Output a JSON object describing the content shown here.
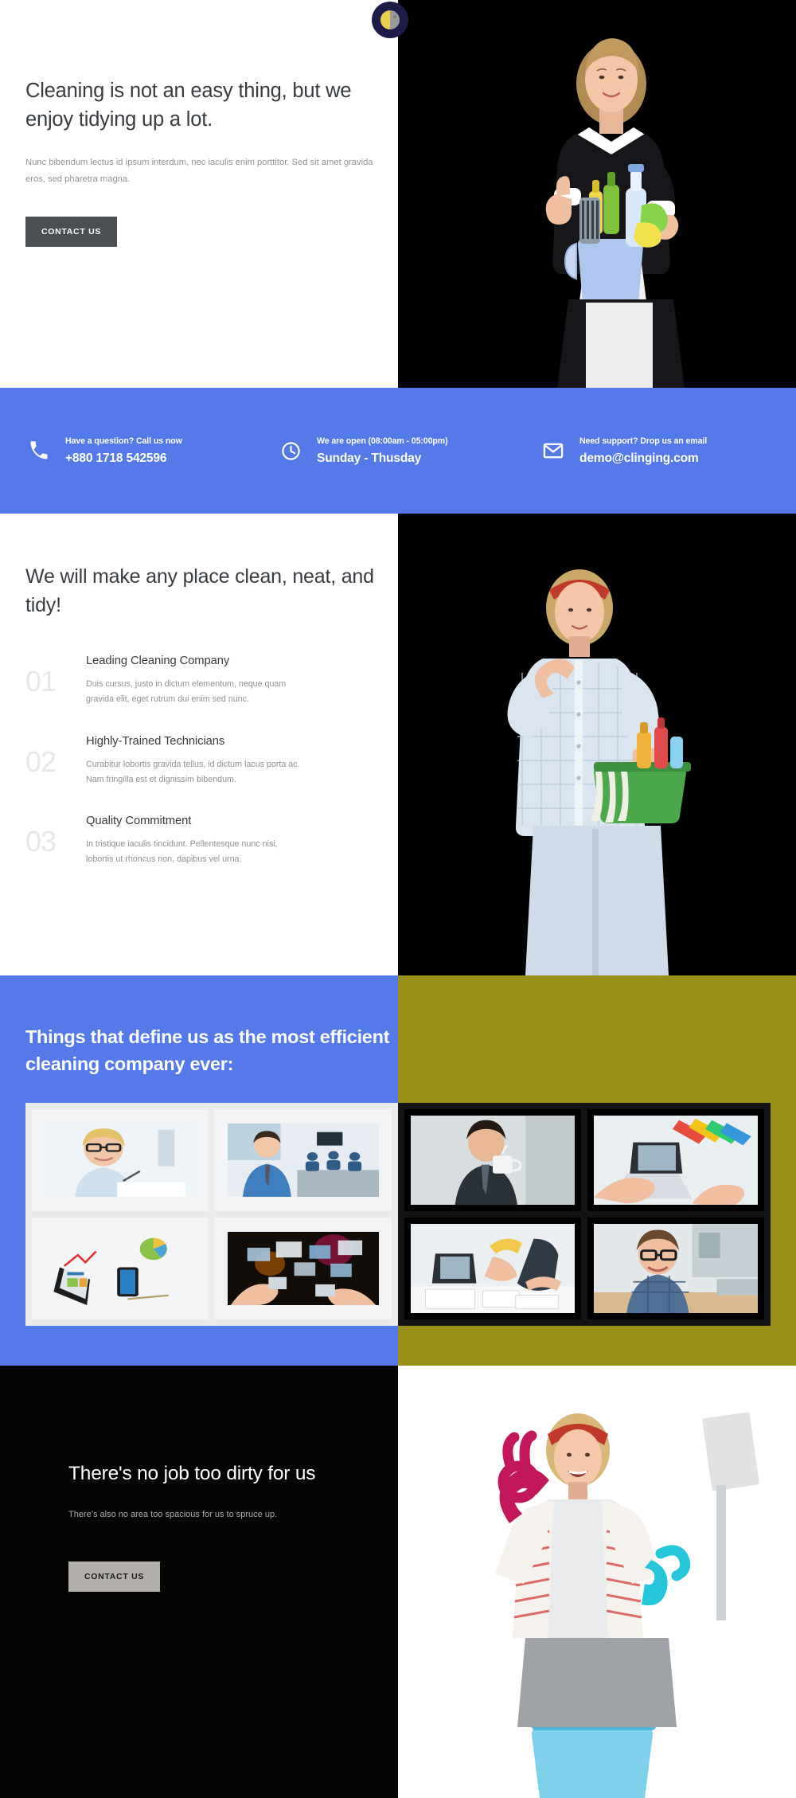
{
  "brand": {
    "logo_icon": "moon-badge-logo"
  },
  "hero": {
    "title": "Cleaning is not an easy thing, but we enjoy tidying up a lot.",
    "subtitle": "Nunc bibendum lectus id ipsum interdum, nec iaculis enim porttitor. Sed sit amet gravida eros, sed pharetra magna.",
    "cta_label": "CONTACT US",
    "image_alt": "maid-with-cleaning-supplies"
  },
  "infobar": {
    "background_color": "#5479e8",
    "items": [
      {
        "icon": "phone-icon",
        "label": "Have a question? Call us now",
        "value": "+880 1718 542596"
      },
      {
        "icon": "clock-icon",
        "label": "We are open (08:00am - 05:00pm)",
        "value": "Sunday - Thusday"
      },
      {
        "icon": "envelope-icon",
        "label": "Need support? Drop us an email",
        "value": "demo@clinging.com"
      }
    ]
  },
  "features": {
    "title": "We will make any place clean, neat, and tidy!",
    "items": [
      {
        "number": "01",
        "title": "Leading Cleaning Company",
        "desc": "Duis cursus, justo in dictum elementum, neque quam gravida elit, eget rutrum dui enim sed nunc."
      },
      {
        "number": "02",
        "title": "Highly-Trained Technicians",
        "desc": "Curabitur lobortis gravida tellus, id dictum lacus porta ac. Nam fringilla est et dignissim bibendum."
      },
      {
        "number": "03",
        "title": "Quality Commitment",
        "desc": "In tristique iaculis tincidunt. Pellentesque nunc nisi, lobortis ut rhoncus non, dapibus vel urna."
      }
    ],
    "image_alt": "woman-with-cleaning-basket"
  },
  "gallery": {
    "heading": "Things that define us as the most efficient cleaning company ever:",
    "left_background": "#5479e8",
    "right_background": "#9a9018",
    "light_tiles": [
      {
        "alt": "businesswoman-with-glasses-writing"
      },
      {
        "alt": "businessman-in-meeting-room"
      },
      {
        "alt": "tablet-with-business-charts"
      },
      {
        "alt": "hands-holding-digital-screens"
      }
    ],
    "dark_tiles": [
      {
        "alt": "man-drinking-coffee"
      },
      {
        "alt": "hands-on-laptop-with-color-swatches"
      },
      {
        "alt": "team-working-at-desk"
      },
      {
        "alt": "man-with-glasses-smiling-at-office"
      }
    ]
  },
  "cta": {
    "title": "There's no job too dirty for us",
    "subtitle": "There’s also no area too spacious for us to spruce up.",
    "button_label": "CONTACT US",
    "image_alt": "woman-with-gloves-and-mop"
  }
}
